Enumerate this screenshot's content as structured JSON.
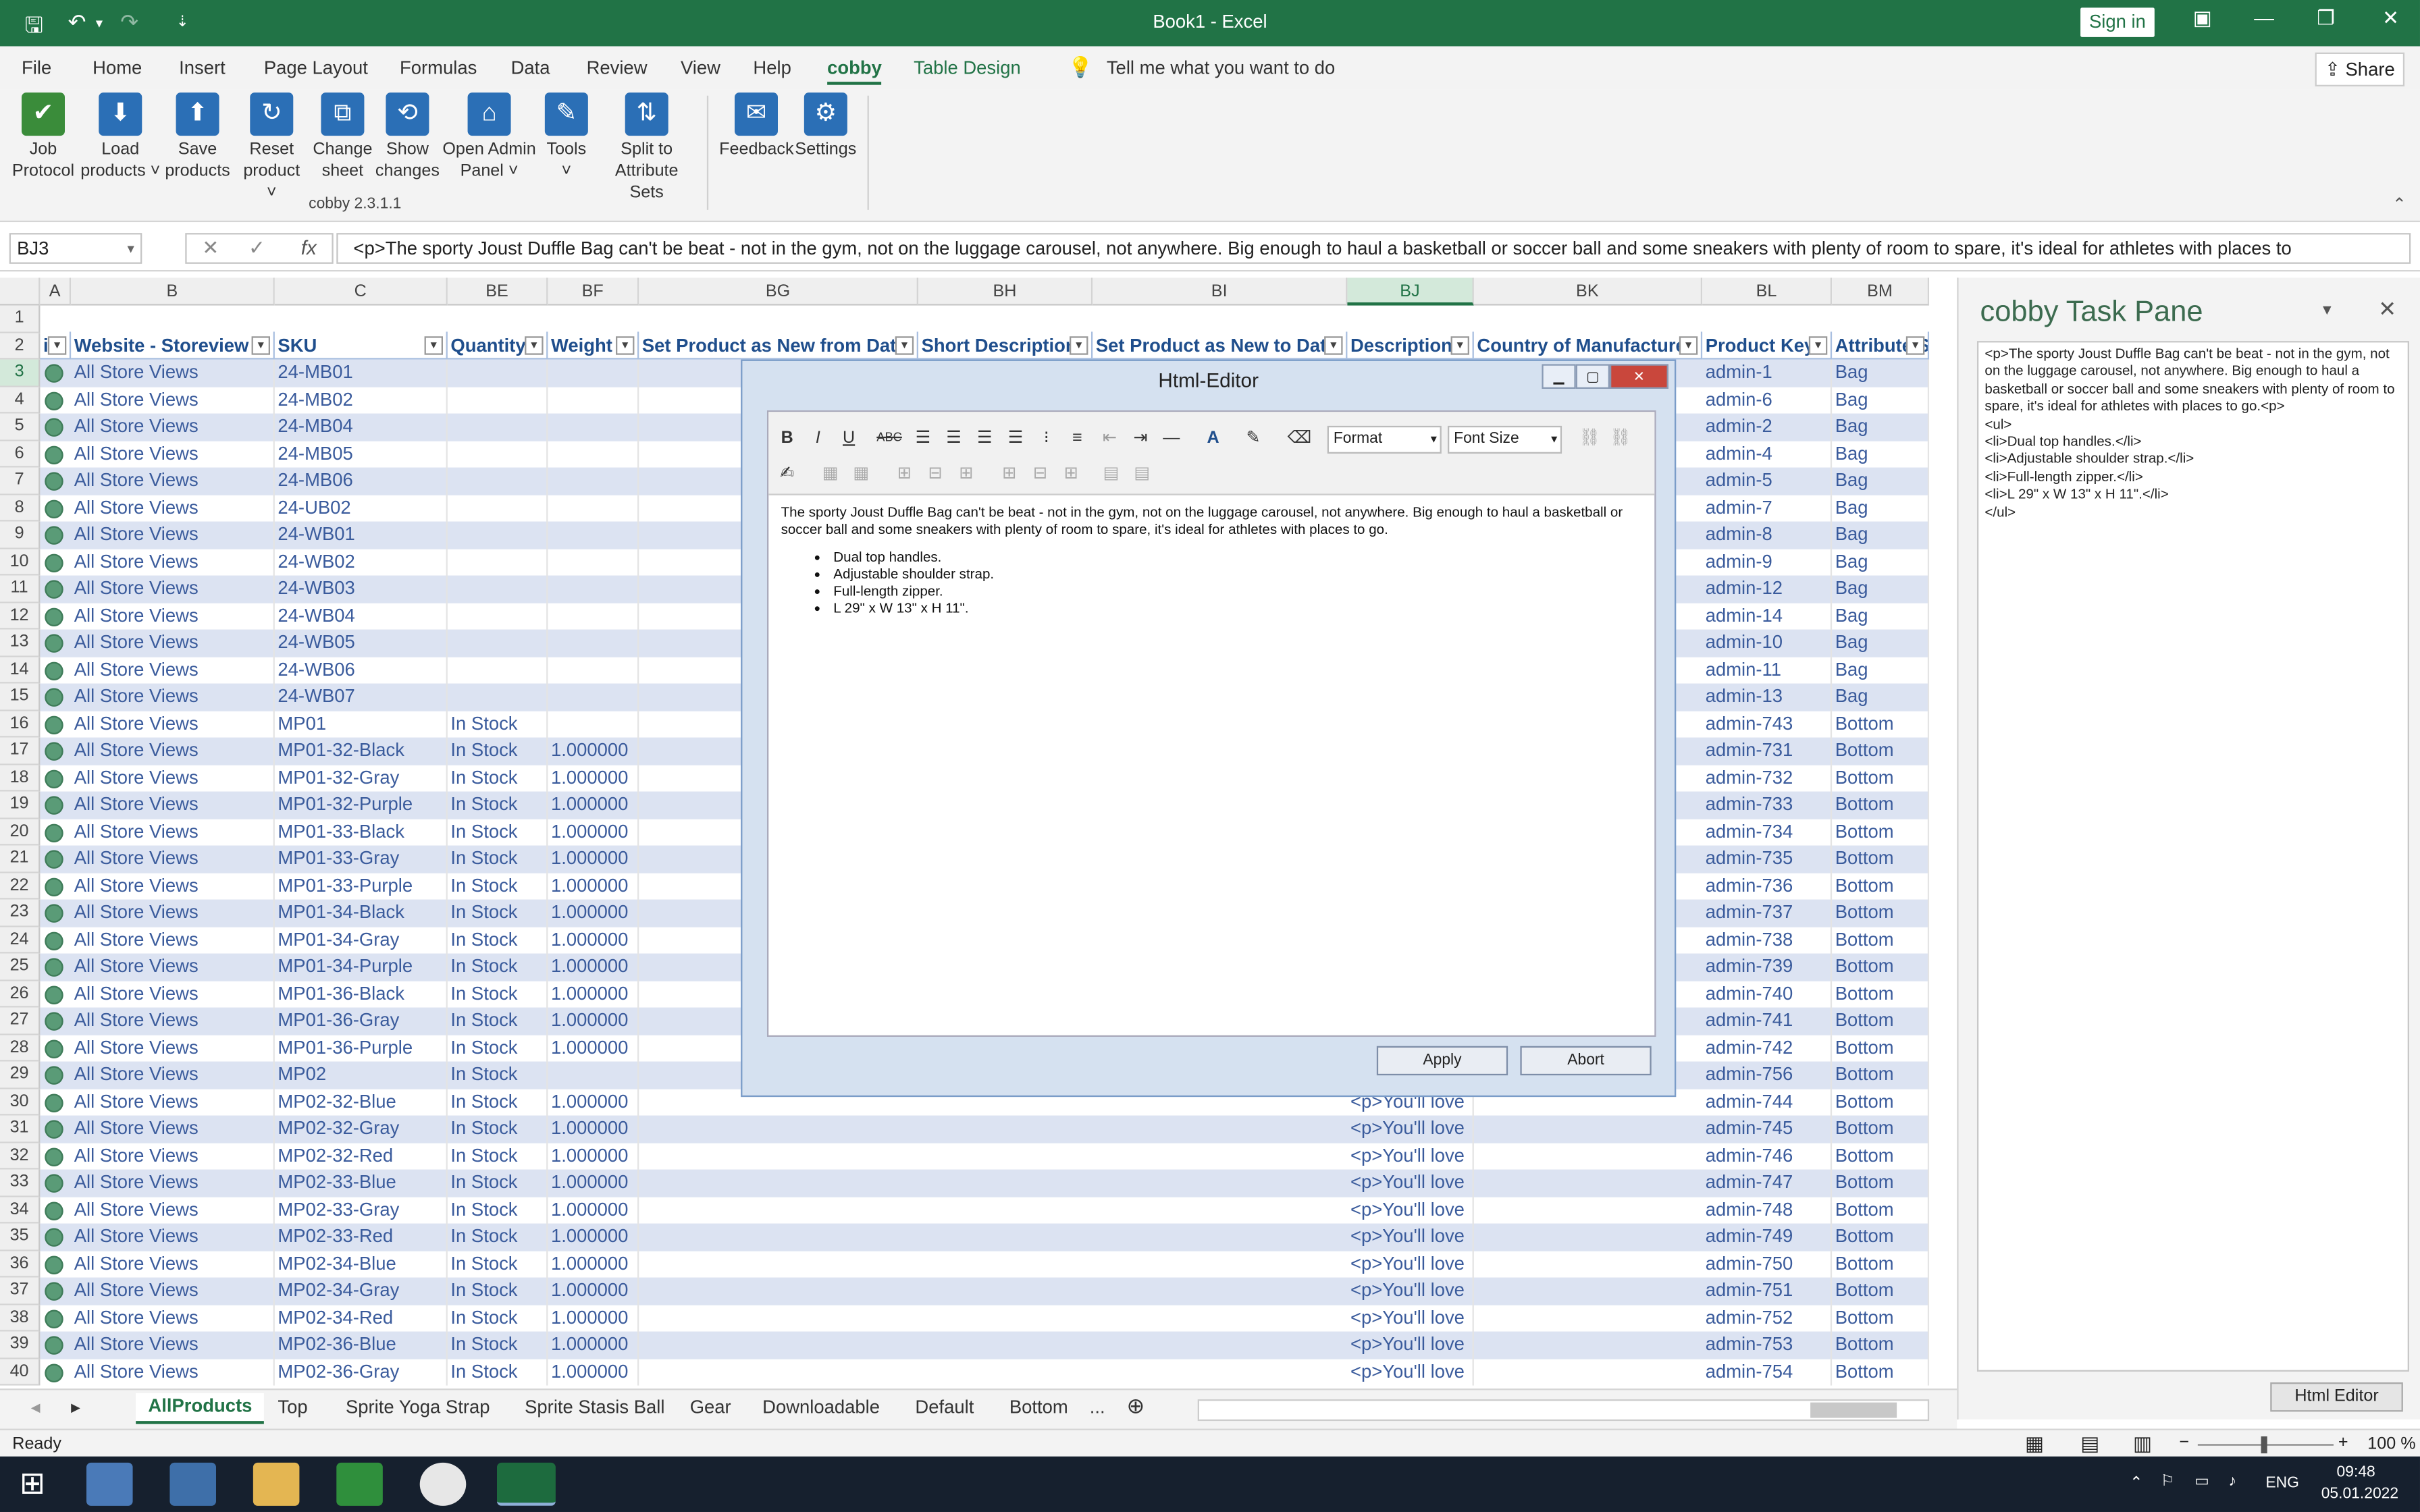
{
  "window": {
    "title": "Book1  -  Excel",
    "signin": "Sign in",
    "minimize": "—",
    "restore": "❐",
    "close": "✕"
  },
  "menu": {
    "items": [
      "File",
      "Home",
      "Insert",
      "Page Layout",
      "Formulas",
      "Data",
      "Review",
      "View",
      "Help"
    ],
    "cobby": "cobby",
    "table_design": "Table Design",
    "tell_me": "Tell me what you want to do",
    "share": "Share"
  },
  "ribbon": {
    "buttons": [
      {
        "label": "Job\nProtocol",
        "icon": "checkmark-icon",
        "glyph": "✔"
      },
      {
        "label": "Load\nproducts ˅",
        "icon": "download-icon",
        "glyph": "⬇"
      },
      {
        "label": "Save\nproducts",
        "icon": "upload-icon",
        "glyph": "⬆"
      },
      {
        "label": "Reset\nproduct ˅",
        "icon": "reset-icon",
        "glyph": "↻"
      },
      {
        "label": "Change\nsheet",
        "icon": "sheet-icon",
        "glyph": "⧉"
      },
      {
        "label": "Show\nchanges",
        "icon": "history-icon",
        "glyph": "⟲"
      },
      {
        "label": "Open Admin\nPanel ˅",
        "icon": "admin-icon",
        "glyph": "⌂"
      },
      {
        "label": "Tools\n˅",
        "icon": "wrench-icon",
        "glyph": "✎"
      },
      {
        "label": "Split to\nAttribute Sets",
        "icon": "split-icon",
        "glyph": "⇅"
      },
      {
        "label": "Feedback",
        "icon": "mail-icon",
        "glyph": "✉"
      },
      {
        "label": "Settings",
        "icon": "gear-icon",
        "glyph": "⚙"
      }
    ],
    "version": "cobby 2.3.1.1"
  },
  "formula_bar": {
    "name_box": "BJ3",
    "text": "<p>The sporty Joust Duffle Bag can't be beat - not in the gym, not on the luggage carousel, not anywhere. Big enough to haul a basketball or soccer ball and some sneakers with plenty of room to spare, it's ideal for athletes with places to"
  },
  "grid": {
    "col_letters": [
      "A",
      "B",
      "C",
      "BE",
      "BF",
      "BG",
      "BH",
      "BI",
      "BJ",
      "BK",
      "BL",
      "BM"
    ],
    "headers": [
      "i",
      "Website - Storeview",
      "SKU",
      "Quantity",
      "Weight",
      "Set Product as New from Date",
      "Short Description",
      "Set Product as New to Date",
      "Description",
      "Country of Manufacture",
      "Product Key",
      "Attribute Se"
    ],
    "rows": [
      {
        "n": "3",
        "store": "All Store Views",
        "sku": "24-MB01",
        "qty": "",
        "weight": "",
        "desc": "",
        "key": "admin-1",
        "attr": "Bag"
      },
      {
        "n": "4",
        "store": "All Store Views",
        "sku": "24-MB02",
        "qty": "",
        "weight": "",
        "desc": "",
        "key": "admin-6",
        "attr": "Bag"
      },
      {
        "n": "5",
        "store": "All Store Views",
        "sku": "24-MB04",
        "qty": "",
        "weight": "",
        "desc": "",
        "key": "admin-2",
        "attr": "Bag"
      },
      {
        "n": "6",
        "store": "All Store Views",
        "sku": "24-MB05",
        "qty": "",
        "weight": "",
        "desc": "",
        "key": "admin-4",
        "attr": "Bag"
      },
      {
        "n": "7",
        "store": "All Store Views",
        "sku": "24-MB06",
        "qty": "",
        "weight": "",
        "desc": "",
        "key": "admin-5",
        "attr": "Bag"
      },
      {
        "n": "8",
        "store": "All Store Views",
        "sku": "24-UB02",
        "qty": "",
        "weight": "",
        "desc": "",
        "key": "admin-7",
        "attr": "Bag"
      },
      {
        "n": "9",
        "store": "All Store Views",
        "sku": "24-WB01",
        "qty": "",
        "weight": "",
        "desc": "",
        "key": "admin-8",
        "attr": "Bag"
      },
      {
        "n": "10",
        "store": "All Store Views",
        "sku": "24-WB02",
        "qty": "",
        "weight": "",
        "desc": "",
        "key": "admin-9",
        "attr": "Bag"
      },
      {
        "n": "11",
        "store": "All Store Views",
        "sku": "24-WB03",
        "qty": "",
        "weight": "",
        "desc": "",
        "key": "admin-12",
        "attr": "Bag"
      },
      {
        "n": "12",
        "store": "All Store Views",
        "sku": "24-WB04",
        "qty": "",
        "weight": "",
        "desc": "",
        "key": "admin-14",
        "attr": "Bag"
      },
      {
        "n": "13",
        "store": "All Store Views",
        "sku": "24-WB05",
        "qty": "",
        "weight": "",
        "desc": "",
        "key": "admin-10",
        "attr": "Bag"
      },
      {
        "n": "14",
        "store": "All Store Views",
        "sku": "24-WB06",
        "qty": "",
        "weight": "",
        "desc": "",
        "key": "admin-11",
        "attr": "Bag"
      },
      {
        "n": "15",
        "store": "All Store Views",
        "sku": "24-WB07",
        "qty": "",
        "weight": "",
        "desc": "",
        "key": "admin-13",
        "attr": "Bag"
      },
      {
        "n": "16",
        "store": "All Store Views",
        "sku": "MP01",
        "qty": "In Stock",
        "weight": "",
        "desc": "",
        "key": "admin-743",
        "attr": "Bottom"
      },
      {
        "n": "17",
        "store": "All Store Views",
        "sku": "MP01-32-Black",
        "qty": "In Stock",
        "weight": "1.000000",
        "desc": "",
        "key": "admin-731",
        "attr": "Bottom"
      },
      {
        "n": "18",
        "store": "All Store Views",
        "sku": "MP01-32-Gray",
        "qty": "In Stock",
        "weight": "1.000000",
        "desc": "",
        "key": "admin-732",
        "attr": "Bottom"
      },
      {
        "n": "19",
        "store": "All Store Views",
        "sku": "MP01-32-Purple",
        "qty": "In Stock",
        "weight": "1.000000",
        "desc": "",
        "key": "admin-733",
        "attr": "Bottom"
      },
      {
        "n": "20",
        "store": "All Store Views",
        "sku": "MP01-33-Black",
        "qty": "In Stock",
        "weight": "1.000000",
        "desc": "",
        "key": "admin-734",
        "attr": "Bottom"
      },
      {
        "n": "21",
        "store": "All Store Views",
        "sku": "MP01-33-Gray",
        "qty": "In Stock",
        "weight": "1.000000",
        "desc": "",
        "key": "admin-735",
        "attr": "Bottom"
      },
      {
        "n": "22",
        "store": "All Store Views",
        "sku": "MP01-33-Purple",
        "qty": "In Stock",
        "weight": "1.000000",
        "desc": "",
        "key": "admin-736",
        "attr": "Bottom"
      },
      {
        "n": "23",
        "store": "All Store Views",
        "sku": "MP01-34-Black",
        "qty": "In Stock",
        "weight": "1.000000",
        "desc": "",
        "key": "admin-737",
        "attr": "Bottom"
      },
      {
        "n": "24",
        "store": "All Store Views",
        "sku": "MP01-34-Gray",
        "qty": "In Stock",
        "weight": "1.000000",
        "desc": "",
        "key": "admin-738",
        "attr": "Bottom"
      },
      {
        "n": "25",
        "store": "All Store Views",
        "sku": "MP01-34-Purple",
        "qty": "In Stock",
        "weight": "1.000000",
        "desc": "",
        "key": "admin-739",
        "attr": "Bottom"
      },
      {
        "n": "26",
        "store": "All Store Views",
        "sku": "MP01-36-Black",
        "qty": "In Stock",
        "weight": "1.000000",
        "desc": "",
        "key": "admin-740",
        "attr": "Bottom"
      },
      {
        "n": "27",
        "store": "All Store Views",
        "sku": "MP01-36-Gray",
        "qty": "In Stock",
        "weight": "1.000000",
        "desc": "",
        "key": "admin-741",
        "attr": "Bottom"
      },
      {
        "n": "28",
        "store": "All Store Views",
        "sku": "MP01-36-Purple",
        "qty": "In Stock",
        "weight": "1.000000",
        "desc": "",
        "key": "admin-742",
        "attr": "Bottom"
      },
      {
        "n": "29",
        "store": "All Store Views",
        "sku": "MP02",
        "qty": "In Stock",
        "weight": "",
        "desc": "",
        "key": "admin-756",
        "attr": "Bottom"
      },
      {
        "n": "30",
        "store": "All Store Views",
        "sku": "MP02-32-Blue",
        "qty": "In Stock",
        "weight": "1.000000",
        "desc": "<p>You'll love",
        "key": "admin-744",
        "attr": "Bottom"
      },
      {
        "n": "31",
        "store": "All Store Views",
        "sku": "MP02-32-Gray",
        "qty": "In Stock",
        "weight": "1.000000",
        "desc": "<p>You'll love",
        "key": "admin-745",
        "attr": "Bottom"
      },
      {
        "n": "32",
        "store": "All Store Views",
        "sku": "MP02-32-Red",
        "qty": "In Stock",
        "weight": "1.000000",
        "desc": "<p>You'll love",
        "key": "admin-746",
        "attr": "Bottom"
      },
      {
        "n": "33",
        "store": "All Store Views",
        "sku": "MP02-33-Blue",
        "qty": "In Stock",
        "weight": "1.000000",
        "desc": "<p>You'll love",
        "key": "admin-747",
        "attr": "Bottom"
      },
      {
        "n": "34",
        "store": "All Store Views",
        "sku": "MP02-33-Gray",
        "qty": "In Stock",
        "weight": "1.000000",
        "desc": "<p>You'll love",
        "key": "admin-748",
        "attr": "Bottom"
      },
      {
        "n": "35",
        "store": "All Store Views",
        "sku": "MP02-33-Red",
        "qty": "In Stock",
        "weight": "1.000000",
        "desc": "<p>You'll love",
        "key": "admin-749",
        "attr": "Bottom"
      },
      {
        "n": "36",
        "store": "All Store Views",
        "sku": "MP02-34-Blue",
        "qty": "In Stock",
        "weight": "1.000000",
        "desc": "<p>You'll love",
        "key": "admin-750",
        "attr": "Bottom"
      },
      {
        "n": "37",
        "store": "All Store Views",
        "sku": "MP02-34-Gray",
        "qty": "In Stock",
        "weight": "1.000000",
        "desc": "<p>You'll love",
        "key": "admin-751",
        "attr": "Bottom"
      },
      {
        "n": "38",
        "store": "All Store Views",
        "sku": "MP02-34-Red",
        "qty": "In Stock",
        "weight": "1.000000",
        "desc": "<p>You'll love",
        "key": "admin-752",
        "attr": "Bottom"
      },
      {
        "n": "39",
        "store": "All Store Views",
        "sku": "MP02-36-Blue",
        "qty": "In Stock",
        "weight": "1.000000",
        "desc": "<p>You'll love",
        "key": "admin-753",
        "attr": "Bottom"
      },
      {
        "n": "40",
        "store": "All Store Views",
        "sku": "MP02-36-Gray",
        "qty": "In Stock",
        "weight": "1.000000",
        "desc": "<p>You'll love",
        "key": "admin-754",
        "attr": "Bottom"
      }
    ]
  },
  "dialog": {
    "title": "Html-Editor",
    "format": "Format",
    "font_size": "Font Size",
    "paragraph": "The sporty Joust Duffle Bag can't be beat - not in the gym, not on the luggage carousel, not anywhere. Big enough to haul a basketball or soccer ball and some sneakers with plenty of room to spare, it's ideal for athletes with places to go.",
    "bullets": [
      "Dual top handles.",
      "Adjustable shoulder strap.",
      "Full-length zipper.",
      "L 29\" x W 13\" x H 11\"."
    ],
    "apply": "Apply",
    "abort": "Abort"
  },
  "pane": {
    "title": "cobby Task Pane",
    "source": "<p>The sporty Joust Duffle Bag can't be beat - not in the gym, not on the luggage carousel, not anywhere. Big enough to haul a basketball or soccer ball and some sneakers with plenty of room to spare, it's ideal for athletes with places to go.<p>\n<ul>\n<li>Dual top handles.</li>\n<li>Adjustable shoulder strap.</li>\n<li>Full-length zipper.</li>\n<li>L 29\" x W 13\" x H 11\".</li>\n</ul>",
    "button": "Html Editor"
  },
  "sheets": {
    "active": "AllProducts",
    "others": [
      "Top",
      "Sprite Yoga Strap",
      "Sprite Stasis Ball",
      "Gear",
      "Downloadable",
      "Default",
      "Bottom"
    ],
    "more": "..."
  },
  "status": {
    "ready": "Ready",
    "zoom": "100 %"
  },
  "taskbar": {
    "lang": "ENG",
    "time": "09:48",
    "date": "05.01.2022"
  },
  "colors": {
    "excel_green": "#217346",
    "band_blue": "#dce3f2",
    "text_blue": "#3a5b9c",
    "close_red": "#c9473c"
  }
}
